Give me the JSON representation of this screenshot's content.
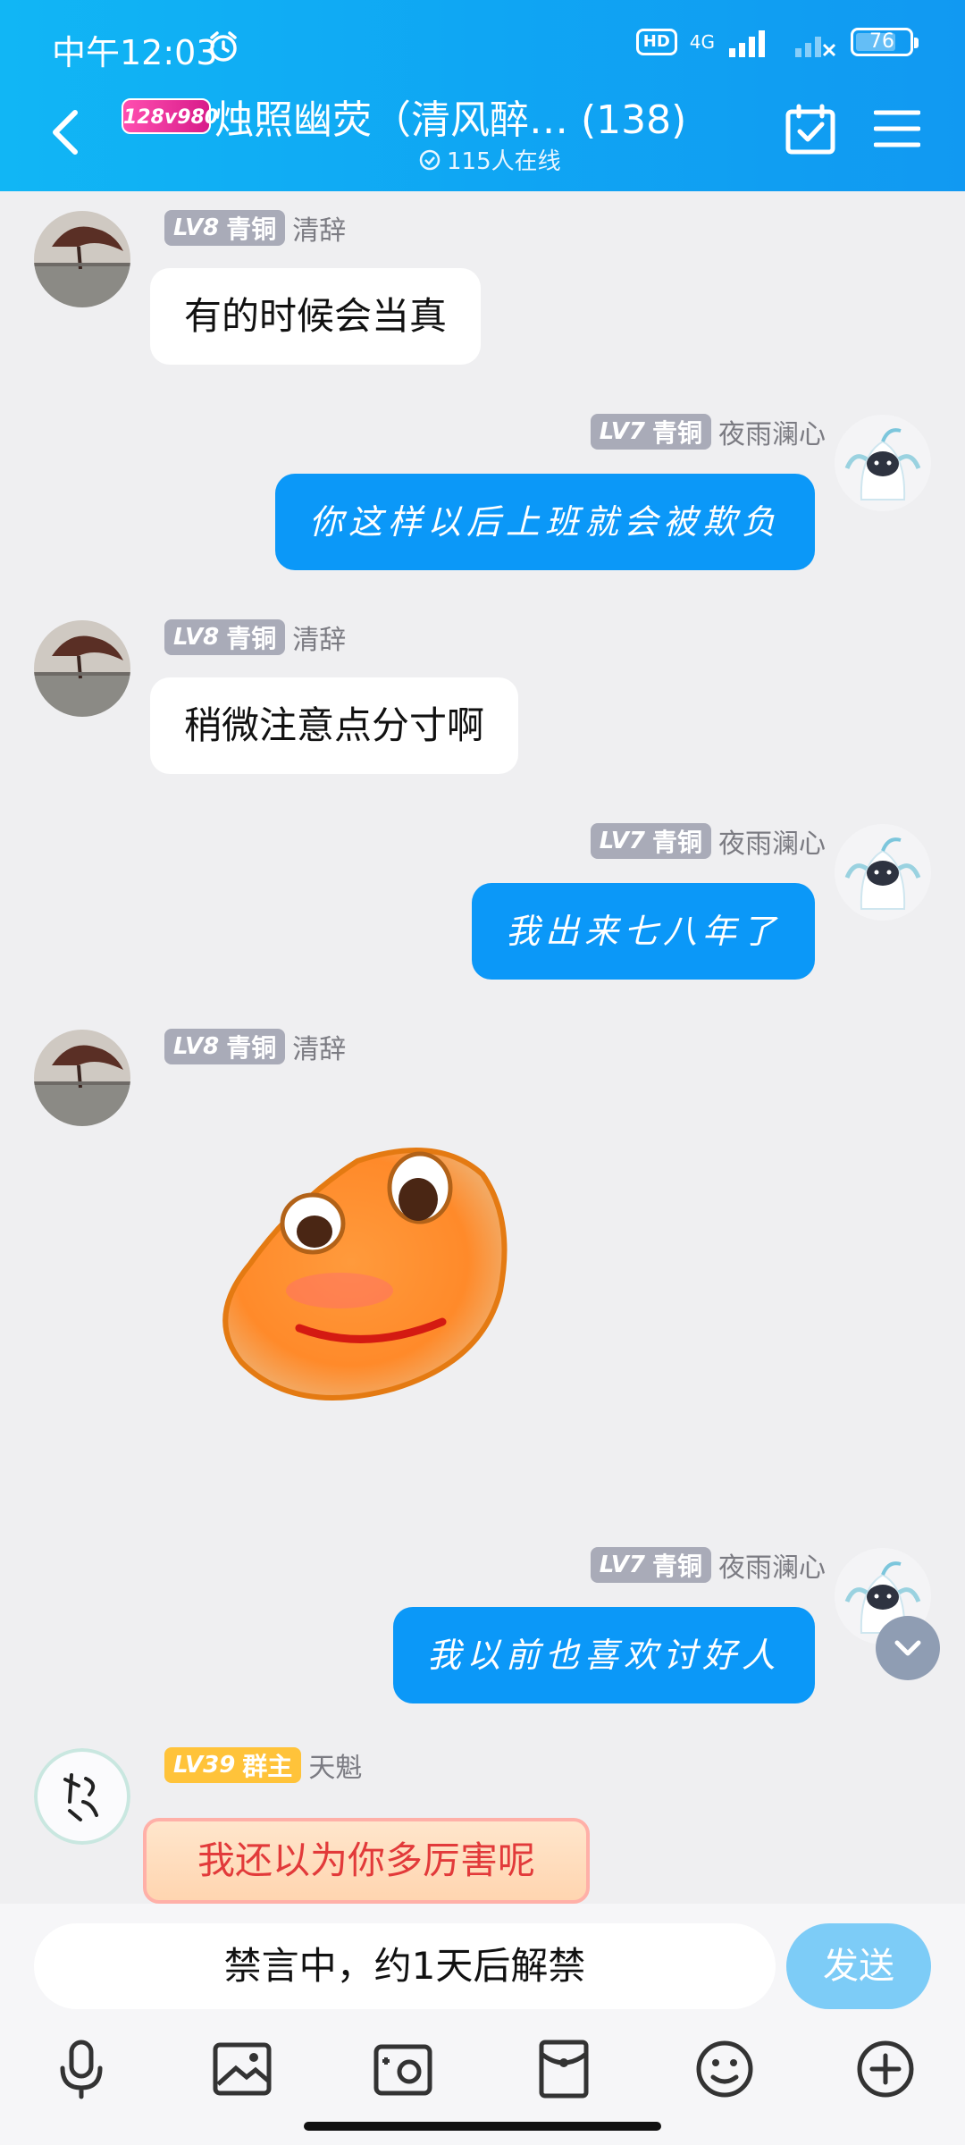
{
  "status_bar": {
    "time": "中午12:03",
    "hd": "HD",
    "network": "4G",
    "battery": "76",
    "battery_level": 0.76
  },
  "header": {
    "group_badge": "128v980",
    "title": "烛照幽荧（清风醉…  (138)",
    "online": "115人在线"
  },
  "messages": [
    {
      "side": "in",
      "level": "LV8",
      "rank": "青铜",
      "nick": "清辞",
      "text": "有的时候会当真"
    },
    {
      "side": "out",
      "level": "LV7",
      "rank": "青铜",
      "nick": "夜雨澜心",
      "text": "你这样以后上班就会被欺负"
    },
    {
      "side": "in",
      "level": "LV8",
      "rank": "青铜",
      "nick": "清辞",
      "text": "稍微注意点分寸啊"
    },
    {
      "side": "out",
      "level": "LV7",
      "rank": "青铜",
      "nick": "夜雨澜心",
      "text": "我出来七八年了"
    },
    {
      "side": "in",
      "level": "LV8",
      "rank": "青铜",
      "nick": "清辞",
      "text": ""
    },
    {
      "side": "out",
      "level": "LV7",
      "rank": "青铜",
      "nick": "夜雨澜心",
      "text": "我以前也喜欢讨好人"
    },
    {
      "side": "in",
      "level": "LV39",
      "rank": "群主",
      "nick": "天魁",
      "text": "我还以为你多厉害呢"
    }
  ],
  "input": {
    "muted_text": "禁言中，约1天后解禁",
    "send_label": "发送"
  },
  "colors": {
    "header": "#11a9f4",
    "out_bubble": "#0b98f8",
    "owner_badge": "#ffc33a"
  },
  "toolbar_icons": [
    "microphone-icon",
    "image-icon",
    "camera-icon",
    "red-packet-icon",
    "emoji-icon",
    "plus-icon"
  ]
}
